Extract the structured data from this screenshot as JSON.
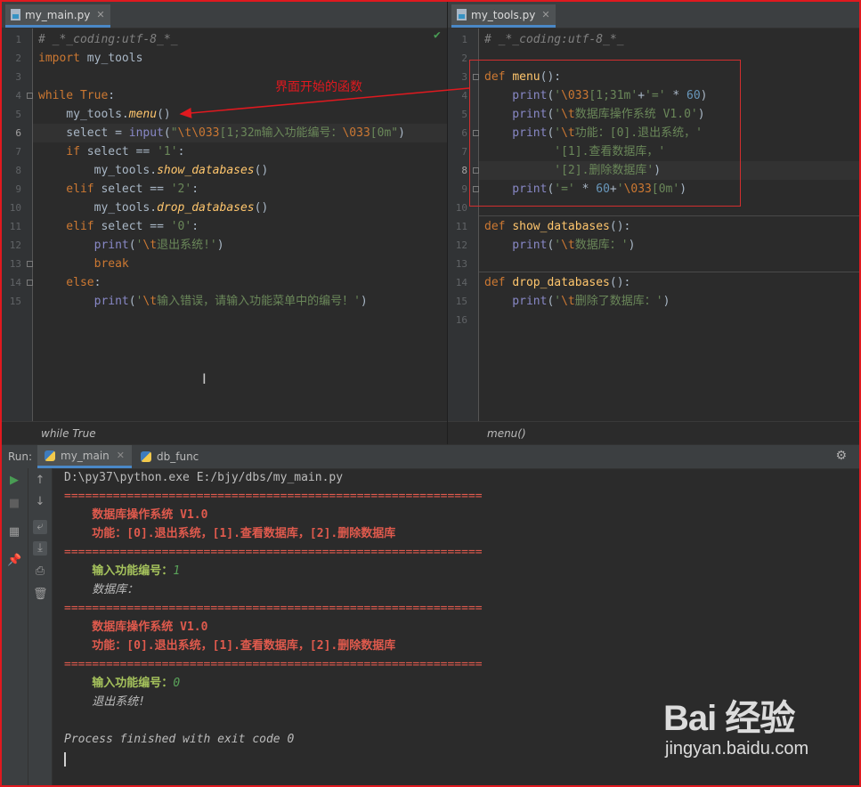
{
  "left_editor": {
    "tab_label": "my_main.py",
    "breadcrumb": "while True",
    "lines": [
      {
        "n": "1",
        "tokens": [
          [
            "cm",
            "# _*_coding:utf-8_*_"
          ]
        ]
      },
      {
        "n": "2",
        "tokens": [
          [
            "kw",
            "import "
          ],
          [
            "pu",
            "my_tools"
          ]
        ]
      },
      {
        "n": "3",
        "tokens": []
      },
      {
        "n": "4",
        "tokens": [
          [
            "kw",
            "while "
          ],
          [
            "kw",
            "True"
          ],
          [
            "pu",
            ":"
          ]
        ]
      },
      {
        "n": "5",
        "tokens": [
          [
            "pu",
            "    my_tools."
          ],
          [
            "fn it",
            "menu"
          ],
          [
            "pu",
            "()"
          ]
        ]
      },
      {
        "n": "6",
        "tokens": [
          [
            "pu",
            "    select = "
          ],
          [
            "bi",
            "input"
          ],
          [
            "pu",
            "("
          ],
          [
            "st",
            "\""
          ],
          [
            "esc",
            "\\t\\033"
          ],
          [
            "st",
            "[1;32m输入功能编号："
          ],
          [
            "esc",
            "\\033"
          ],
          [
            "st",
            "[0m\""
          ],
          [
            "pu",
            ")"
          ]
        ]
      },
      {
        "n": "7",
        "tokens": [
          [
            "kw",
            "    if "
          ],
          [
            "pu",
            "select == "
          ],
          [
            "st",
            "'1'"
          ],
          [
            "pu",
            ":"
          ]
        ]
      },
      {
        "n": "8",
        "tokens": [
          [
            "pu",
            "        my_tools."
          ],
          [
            "fn it",
            "show_databases"
          ],
          [
            "pu",
            "()"
          ]
        ]
      },
      {
        "n": "9",
        "tokens": [
          [
            "kw",
            "    elif "
          ],
          [
            "pu",
            "select == "
          ],
          [
            "st",
            "'2'"
          ],
          [
            "pu",
            ":"
          ]
        ]
      },
      {
        "n": "10",
        "tokens": [
          [
            "pu",
            "        my_tools."
          ],
          [
            "fn it",
            "drop_databases"
          ],
          [
            "pu",
            "()"
          ]
        ]
      },
      {
        "n": "11",
        "tokens": [
          [
            "kw",
            "    elif "
          ],
          [
            "pu",
            "select == "
          ],
          [
            "st",
            "'0'"
          ],
          [
            "pu",
            ":"
          ]
        ]
      },
      {
        "n": "12",
        "tokens": [
          [
            "bi",
            "        print"
          ],
          [
            "pu",
            "("
          ],
          [
            "st",
            "'"
          ],
          [
            "esc",
            "\\t"
          ],
          [
            "st",
            "退出系统!'"
          ],
          [
            "pu",
            ")"
          ]
        ]
      },
      {
        "n": "13",
        "tokens": [
          [
            "kw",
            "        break"
          ]
        ]
      },
      {
        "n": "14",
        "tokens": [
          [
            "kw",
            "    else"
          ],
          [
            "pu",
            ":"
          ]
        ]
      },
      {
        "n": "15",
        "tokens": [
          [
            "bi",
            "        print"
          ],
          [
            "pu",
            "("
          ],
          [
            "st",
            "'"
          ],
          [
            "esc",
            "\\t"
          ],
          [
            "st",
            "输入错误，请输入功能菜单中的编号！'"
          ],
          [
            "pu",
            ")"
          ]
        ]
      }
    ]
  },
  "right_editor": {
    "tab_label": "my_tools.py",
    "breadcrumb": "menu()",
    "lines": [
      {
        "n": "1",
        "tokens": [
          [
            "cm",
            "# _*_coding:utf-8_*_"
          ]
        ]
      },
      {
        "n": "2",
        "tokens": []
      },
      {
        "n": "3",
        "tokens": [
          [
            "kw",
            "def "
          ],
          [
            "fn",
            "menu"
          ],
          [
            "pu",
            "():"
          ]
        ]
      },
      {
        "n": "4",
        "tokens": [
          [
            "bi",
            "    print"
          ],
          [
            "pu",
            "("
          ],
          [
            "st",
            "'"
          ],
          [
            "esc",
            "\\033"
          ],
          [
            "st",
            "[1;31m'"
          ],
          [
            "pu",
            "+"
          ],
          [
            "st",
            "'='"
          ],
          [
            "pu",
            " * "
          ],
          [
            "num",
            "60"
          ],
          [
            "pu",
            ")"
          ]
        ]
      },
      {
        "n": "5",
        "tokens": [
          [
            "bi",
            "    print"
          ],
          [
            "pu",
            "("
          ],
          [
            "st",
            "'"
          ],
          [
            "esc",
            "\\t"
          ],
          [
            "st",
            "数据库操作系统 V1.0'"
          ],
          [
            "pu",
            ")"
          ]
        ]
      },
      {
        "n": "6",
        "tokens": [
          [
            "bi",
            "    print"
          ],
          [
            "pu",
            "("
          ],
          [
            "st",
            "'"
          ],
          [
            "esc",
            "\\t"
          ],
          [
            "st",
            "功能：[0].退出系统，'"
          ]
        ]
      },
      {
        "n": "7",
        "tokens": [
          [
            "st",
            "          '[1].查看数据库，'"
          ]
        ]
      },
      {
        "n": "8",
        "tokens": [
          [
            "st",
            "          '[2].删除数据库'"
          ],
          [
            "pu",
            ")"
          ]
        ]
      },
      {
        "n": "9",
        "tokens": [
          [
            "bi",
            "    print"
          ],
          [
            "pu",
            "("
          ],
          [
            "st",
            "'='"
          ],
          [
            "pu",
            " * "
          ],
          [
            "num",
            "60"
          ],
          [
            "pu",
            "+"
          ],
          [
            "st",
            "'"
          ],
          [
            "esc",
            "\\033"
          ],
          [
            "st",
            "[0m'"
          ],
          [
            "pu",
            ")"
          ]
        ]
      },
      {
        "n": "10",
        "tokens": []
      },
      {
        "n": "11",
        "tokens": [
          [
            "kw",
            "def "
          ],
          [
            "fn",
            "show_databases"
          ],
          [
            "pu",
            "():"
          ]
        ]
      },
      {
        "n": "12",
        "tokens": [
          [
            "bi",
            "    print"
          ],
          [
            "pu",
            "("
          ],
          [
            "st",
            "'"
          ],
          [
            "esc",
            "\\t"
          ],
          [
            "st",
            "数据库：'"
          ],
          [
            "pu",
            ")"
          ]
        ]
      },
      {
        "n": "13",
        "tokens": []
      },
      {
        "n": "14",
        "tokens": [
          [
            "kw",
            "def "
          ],
          [
            "fn",
            "drop_databases"
          ],
          [
            "pu",
            "():"
          ]
        ]
      },
      {
        "n": "15",
        "tokens": [
          [
            "bi",
            "    print"
          ],
          [
            "pu",
            "("
          ],
          [
            "st",
            "'"
          ],
          [
            "esc",
            "\\t"
          ],
          [
            "st",
            "删除了数据库：'"
          ],
          [
            "pu",
            ")"
          ]
        ]
      },
      {
        "n": "16",
        "tokens": []
      }
    ]
  },
  "annotation": {
    "text": "界面开始的函数",
    "color": "#e0191f"
  },
  "run": {
    "label": "Run:",
    "tabs": [
      {
        "label": "my_main",
        "active": true
      },
      {
        "label": "db_func",
        "active": false
      }
    ],
    "console": [
      {
        "style": "plain",
        "text": "D:\\py37\\python.exe E:/bjy/dbs/my_main.py"
      },
      {
        "style": "red",
        "text": "============================================================"
      },
      {
        "style": "red-bold",
        "text": "    数据库操作系统 V1.0"
      },
      {
        "style": "red-bold",
        "text": "    功能：[0].退出系统，[1].查看数据库，[2].删除数据库"
      },
      {
        "style": "red",
        "text": "============================================================"
      },
      {
        "style": "prompt",
        "text": "    输入功能编号：",
        "input": "1"
      },
      {
        "style": "italic",
        "text": "    数据库："
      },
      {
        "style": "red",
        "text": "============================================================"
      },
      {
        "style": "red-bold",
        "text": "    数据库操作系统 V1.0"
      },
      {
        "style": "red-bold",
        "text": "    功能：[0].退出系统，[1].查看数据库，[2].删除数据库"
      },
      {
        "style": "red",
        "text": "============================================================"
      },
      {
        "style": "prompt",
        "text": "    输入功能编号：",
        "input": "0"
      },
      {
        "style": "italic",
        "text": "    退出系统!"
      },
      {
        "style": "plain",
        "text": ""
      },
      {
        "style": "italic",
        "text": "Process finished with exit code 0"
      }
    ]
  },
  "watermark": {
    "logo": "Bai 经验",
    "sub": "jingyan.baidu.com"
  }
}
